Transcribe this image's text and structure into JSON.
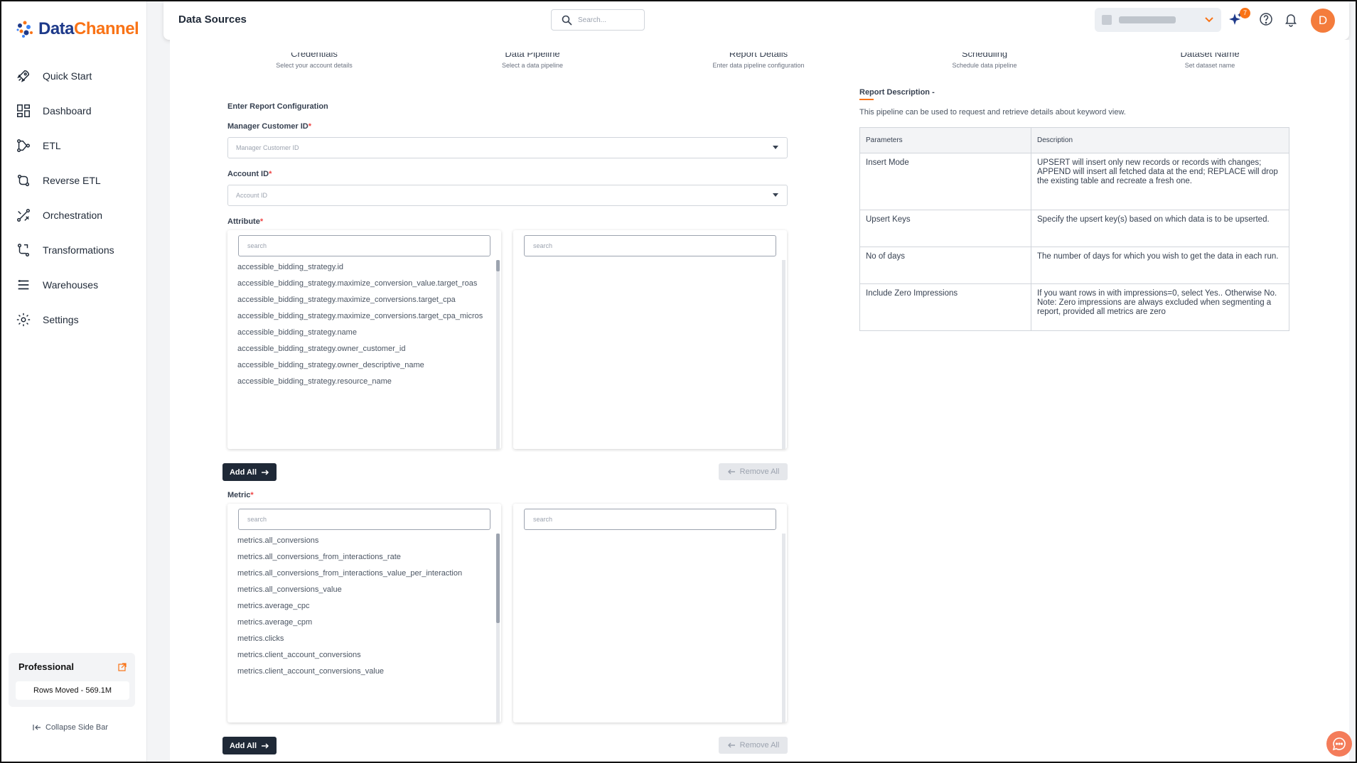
{
  "app": {
    "name_part1": "Data",
    "name_part2": "Channel"
  },
  "header": {
    "title": "Data Sources",
    "search_placeholder": "Search...",
    "notification_badge": "7",
    "avatar_letter": "D"
  },
  "sidebar": {
    "items": [
      {
        "label": "Quick Start",
        "icon": "rocket-icon"
      },
      {
        "label": "Dashboard",
        "icon": "dashboard-grid-icon"
      },
      {
        "label": "ETL",
        "icon": "etl-flow-icon"
      },
      {
        "label": "Reverse ETL",
        "icon": "reverse-etl-icon"
      },
      {
        "label": "Orchestration",
        "icon": "orchestration-icon"
      },
      {
        "label": "Transformations",
        "icon": "transform-icon"
      },
      {
        "label": "Warehouses",
        "icon": "warehouse-icon"
      },
      {
        "label": "Settings",
        "icon": "gear-icon"
      }
    ],
    "plan": {
      "title": "Professional",
      "rows_moved": "Rows Moved - 569.1M"
    },
    "collapse_label": "Collapse Side Bar"
  },
  "stepper": [
    {
      "title": "Credentials",
      "subtitle": "Select your account details"
    },
    {
      "title": "Data Pipeline",
      "subtitle": "Select a data pipeline"
    },
    {
      "title": "Report Details",
      "subtitle": "Enter data pipeline configuration"
    },
    {
      "title": "Scheduling",
      "subtitle": "Schedule data pipeline"
    },
    {
      "title": "Dataset Name",
      "subtitle": "Set dataset name"
    }
  ],
  "form": {
    "section_title": "Enter Report Configuration",
    "manager_label": "Manager Customer ID",
    "manager_placeholder": "Manager Customer ID",
    "account_label": "Account ID",
    "account_placeholder": "Account ID",
    "required_mark": "*",
    "attribute": {
      "label": "Attribute",
      "search_placeholder": "search",
      "selected_search_placeholder": "search",
      "items": [
        "accessible_bidding_strategy.id",
        "accessible_bidding_strategy.maximize_conversion_value.target_roas",
        "accessible_bidding_strategy.maximize_conversions.target_cpa",
        "accessible_bidding_strategy.maximize_conversions.target_cpa_micros",
        "accessible_bidding_strategy.name",
        "accessible_bidding_strategy.owner_customer_id",
        "accessible_bidding_strategy.owner_descriptive_name",
        "accessible_bidding_strategy.resource_name"
      ],
      "add_all": "Add All",
      "remove_all": "Remove All"
    },
    "metric": {
      "label": "Metric",
      "search_placeholder": "search",
      "selected_search_placeholder": "search",
      "items": [
        "metrics.all_conversions",
        "metrics.all_conversions_from_interactions_rate",
        "metrics.all_conversions_from_interactions_value_per_interaction",
        "metrics.all_conversions_value",
        "metrics.average_cpc",
        "metrics.average_cpm",
        "metrics.clicks",
        "metrics.client_account_conversions",
        "metrics.client_account_conversions_value"
      ],
      "add_all": "Add All",
      "remove_all": "Remove All"
    }
  },
  "description": {
    "title": "Report Description -",
    "text": "This pipeline can be used to request and retrieve details about keyword view.",
    "table_headers": [
      "Parameters",
      "Description"
    ],
    "rows": [
      {
        "param": "Insert Mode",
        "desc": "UPSERT will insert only new records or records with changes; APPEND will insert all fetched data at the end; REPLACE will drop the existing table and recreate a fresh one."
      },
      {
        "param": "Upsert Keys",
        "desc": "Specify the upsert key(s) based on which data is to be upserted."
      },
      {
        "param": "No of days",
        "desc": "The number of days for which you wish to get the data in each run."
      },
      {
        "param": "Include Zero Impressions",
        "desc": "If you want rows in with impressions=0, select Yes.. Otherwise No. Note: Zero impressions are always excluded when segmenting a report, provided all metrics are zero"
      }
    ]
  },
  "colors": {
    "accent": "#f97316",
    "brand_blue": "#1e3a8a",
    "dark_button": "#1f2937"
  }
}
